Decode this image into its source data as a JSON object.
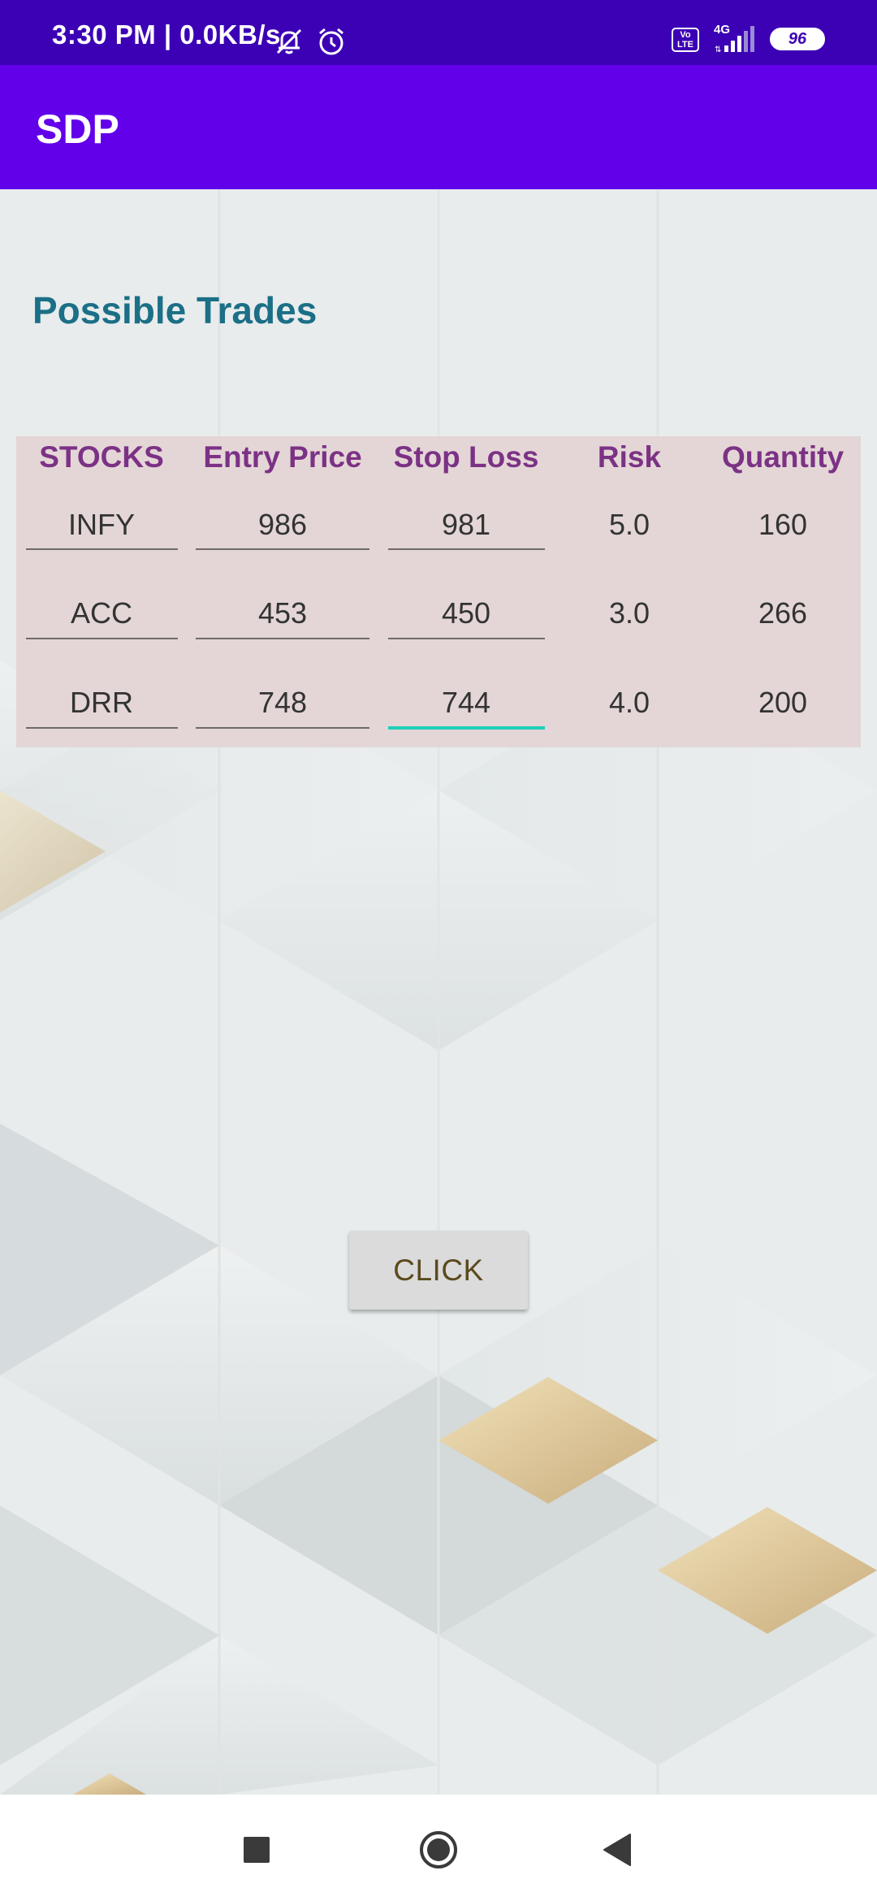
{
  "status_bar": {
    "time_speed": "3:30 PM | 0.0KB/s",
    "volte_label": "Vo\nLTE",
    "network_type": "4G",
    "battery_level": "96",
    "icons": [
      "silent-bell-icon",
      "alarm-icon",
      "volte-icon",
      "signal-icon",
      "battery-icon"
    ]
  },
  "app_bar": {
    "title": "SDP"
  },
  "main": {
    "heading": "Possible Trades",
    "table": {
      "headers": [
        "STOCKS",
        "Entry Price",
        "Stop Loss",
        "Risk",
        "Quantity"
      ],
      "rows": [
        {
          "stock": "INFY",
          "entry": "986",
          "stop": "981",
          "risk": "5.0",
          "quantity": "160"
        },
        {
          "stock": "ACC",
          "entry": "453",
          "stop": "450",
          "risk": "3.0",
          "quantity": "266"
        },
        {
          "stock": "DRR",
          "entry": "748",
          "stop": "744",
          "risk": "4.0",
          "quantity": "200"
        }
      ]
    },
    "button_label": "CLICK"
  },
  "nav_bar": {
    "icons": [
      "recents-square-icon",
      "home-circle-icon",
      "back-triangle-icon"
    ]
  },
  "colors": {
    "status_bar": "#3c00b5",
    "app_bar": "#6200ea",
    "heading": "#1b6f86",
    "table_header": "#7b3285",
    "table_background": "#e4d6d6",
    "focused_underline": "#1ccfb7",
    "button_background": "#dbdbdb"
  }
}
